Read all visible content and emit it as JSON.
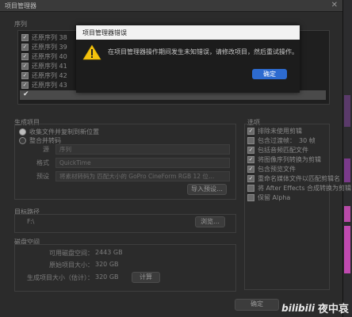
{
  "window": {
    "title": "项目管理器"
  },
  "sequences_section": {
    "label": "序列"
  },
  "sequences": [
    {
      "label": "还原序列 38",
      "checked": true
    },
    {
      "label": "还原序列 39",
      "checked": true
    },
    {
      "label": "还原序列 40",
      "checked": true
    },
    {
      "label": "还原序列 41",
      "checked": true
    },
    {
      "label": "还原序列 42",
      "checked": true
    },
    {
      "label": "还原序列 43",
      "checked": true
    }
  ],
  "resource_section": {
    "label": "生成项目",
    "radio_collect": "收集文件并复制到新位置",
    "radio_consolidate": "整合并转码",
    "source_label": "源",
    "source_value": "序列",
    "format_label": "格式",
    "format_value": "QuickTime",
    "preset_label": "预设",
    "preset_value": "将素材转码为 匹配大小的 GoPro CineForm RGB 12 位…",
    "import_button": "导入预设…"
  },
  "options_section": {
    "label": "选项",
    "items": [
      {
        "label": "排除未使用剪辑",
        "checked": true
      },
      {
        "label": "包含过渡帧：",
        "checked": false,
        "value": "30 帧"
      },
      {
        "label": "包括音频匹配文件",
        "checked": true
      },
      {
        "label": "将图像序列转换为剪辑",
        "checked": true
      },
      {
        "label": "包含预览文件",
        "checked": true
      },
      {
        "label": "重命名媒体文件以匹配剪辑名",
        "checked": true
      },
      {
        "label": "将 After Effects 合成转换为剪辑",
        "checked": false
      },
      {
        "label": "保留 Alpha",
        "checked": false
      }
    ]
  },
  "dest_section": {
    "label": "目标路径",
    "path": "F:\\",
    "browse_button": "浏览…"
  },
  "disk_section": {
    "label": "磁盘空间",
    "available_label": "可用磁盘空间：",
    "available_value": "2443 GB",
    "original_label": "原始项目大小：",
    "original_value": "320 GB",
    "result_label": "生成项目大小（估计）：",
    "result_value": "320 GB",
    "calc_button": "计算"
  },
  "footer": {
    "ok_button": "确定"
  },
  "dialog": {
    "title": "项目管理器错误",
    "icon": "warning-icon",
    "message": "在项目管理器操作期间发生未知错误，请修改项目，然后重试操作。",
    "ok_button": "确定"
  },
  "watermark": {
    "brand": "bilibili",
    "text": "夜中哀"
  },
  "colors": {
    "accent": "#2d6bd0",
    "warning": "#f4c20d"
  }
}
